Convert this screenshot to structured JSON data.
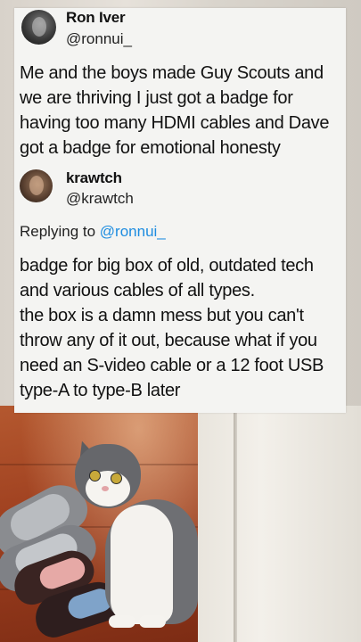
{
  "tweet": {
    "author_name": "Ron Iver",
    "author_handle": "@ronnui_",
    "text_lines": [
      "Me and the boys made Guy Scouts and",
      "we are thriving I just got a badge for",
      "having too many HDMI cables and Dave",
      "got a badge for emotional honesty"
    ]
  },
  "reply": {
    "author_name": "krawtch",
    "author_handle": "@krawtch",
    "replying_prefix": "Replying to",
    "replying_mention": "@ronnui_",
    "text_lines": [
      "badge for big box of old, outdated tech",
      "and various cables of all types.",
      "the box is a damn mess but you can't",
      "throw any of it out, because what if you",
      "need an S-video cable or a 12 foot USB",
      "type-A to type-B later"
    ]
  },
  "colors": {
    "card_background": "#f4f4f2",
    "text": "#111111",
    "mention": "#1d8ce0"
  },
  "background": {
    "description_icons": [
      "slippers-image",
      "cat-image"
    ]
  }
}
